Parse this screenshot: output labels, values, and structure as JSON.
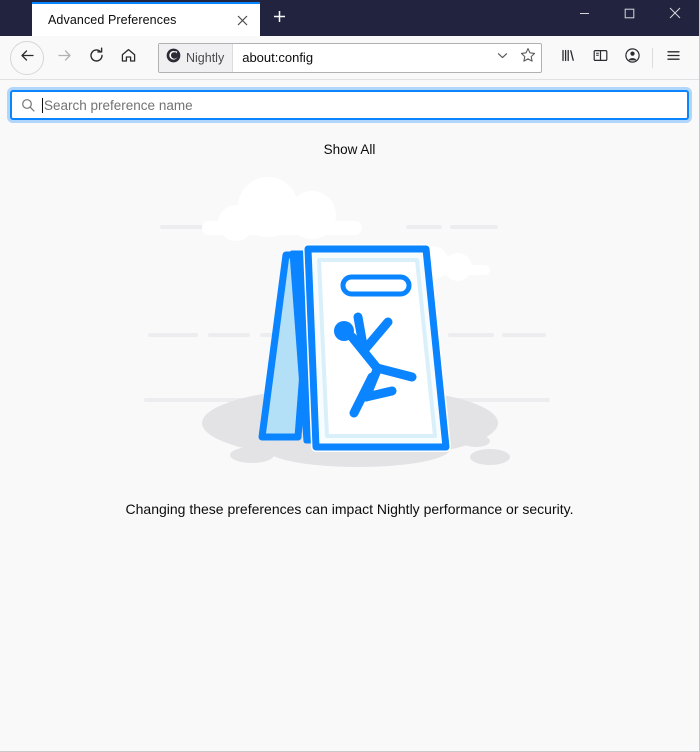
{
  "window": {
    "titlebar_color": "#22243f",
    "accent_color": "#0a84ff",
    "background_color": "#f9f9fa",
    "controls": {
      "minimize_label": "Minimize",
      "maximize_label": "Maximize",
      "close_label": "Close",
      "minimize_icon": "window-minimize-icon",
      "maximize_icon": "window-maximize-icon",
      "close_icon": "window-close-icon"
    }
  },
  "tabs": {
    "items": [
      {
        "title": "Advanced Preferences",
        "active": true,
        "close_icon": "close-icon"
      }
    ],
    "new_tab_label": "+",
    "new_tab_icon": "plus-icon"
  },
  "toolbar": {
    "back_label": "Back",
    "back_icon": "arrow-left-icon",
    "forward_label": "Forward",
    "forward_icon": "arrow-right-icon",
    "reload_label": "Reload",
    "reload_icon": "reload-icon",
    "home_label": "Home",
    "home_icon": "home-icon",
    "library_label": "Library",
    "library_icon": "library-icon",
    "sidebar_label": "Sidebars",
    "sidebar_icon": "sidebar-icon",
    "account_label": "Account",
    "account_icon": "account-avatar-icon",
    "menu_label": "Open application menu",
    "menu_icon": "hamburger-menu-icon"
  },
  "urlbar": {
    "identity_label": "Nightly",
    "identity_icon": "firefox-nightly-logo-icon",
    "url": "about:config",
    "dropdown_icon": "chevron-down-icon",
    "bookmark_icon": "star-icon",
    "bookmark_label": "Bookmark this page"
  },
  "page": {
    "search": {
      "placeholder": "Search preference name",
      "value": "",
      "icon": "search-icon"
    },
    "show_all_label": "Show All",
    "warning_text": "Changing these preferences can impact Nightly performance or security.",
    "illustration": {
      "name": "wet-floor-caution-sign-illustration",
      "sign_color": "#0a84ff",
      "sign_face_color": "#ffffff",
      "sign_side_color": "#b3e0f7",
      "cloud_color": "#ffffff",
      "ground_color": "#e3e3e6"
    }
  }
}
